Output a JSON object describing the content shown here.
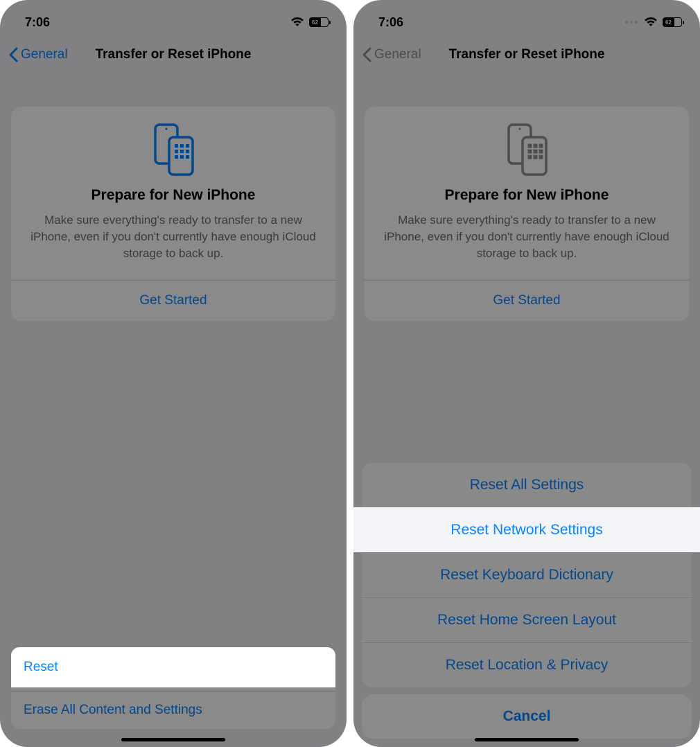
{
  "status": {
    "time": "7:06",
    "battery_text": "62"
  },
  "nav": {
    "back_label": "General",
    "title": "Transfer or Reset iPhone"
  },
  "prepare_card": {
    "title": "Prepare for New iPhone",
    "description": "Make sure everything's ready to transfer to a new iPhone, even if you don't currently have enough iCloud storage to back up.",
    "cta": "Get Started"
  },
  "bottom_actions": {
    "reset_label": "Reset",
    "erase_label": "Erase All Content and Settings"
  },
  "reset_sheet": {
    "options": [
      "Reset All Settings",
      "Reset Network Settings",
      "Reset Keyboard Dictionary",
      "Reset Home Screen Layout",
      "Reset Location & Privacy"
    ],
    "cancel": "Cancel"
  },
  "highlighted": {
    "left": "Reset",
    "right": "Reset Network Settings"
  }
}
